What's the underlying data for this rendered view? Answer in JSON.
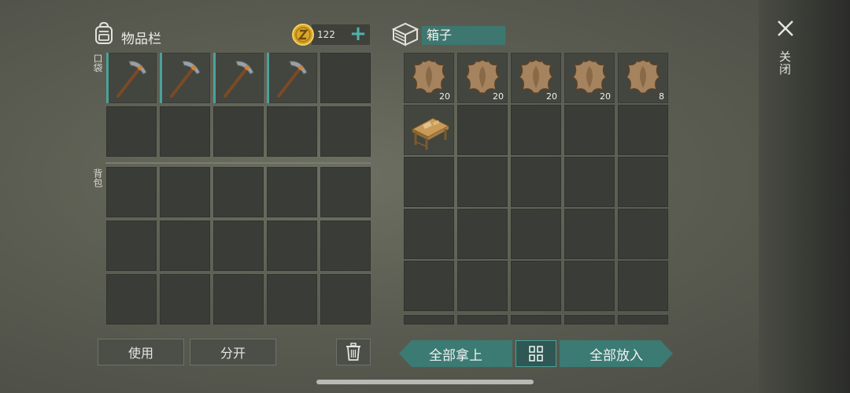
{
  "inventory": {
    "title": "物品栏",
    "pocket_label": "口袋",
    "backpack_label": "背包",
    "coins": "122",
    "coin_add": "+",
    "pocket_items": [
      "pickaxe",
      "pickaxe",
      "pickaxe",
      "pickaxe",
      null,
      null,
      null,
      null,
      null,
      null
    ],
    "backpack_slot_count": 15
  },
  "container": {
    "name": "箱子",
    "items": [
      {
        "item": "hide",
        "qty": "20"
      },
      {
        "item": "hide",
        "qty": "20"
      },
      {
        "item": "hide",
        "qty": "20"
      },
      {
        "item": "hide",
        "qty": "20"
      },
      {
        "item": "hide",
        "qty": "8"
      },
      {
        "item": "workbench",
        "qty": ""
      }
    ],
    "slot_count": 25
  },
  "buttons": {
    "use": "使用",
    "split": "分开",
    "take_all": "全部拿上",
    "put_all": "全部放入",
    "close": "关闭"
  },
  "icons": {
    "bag": "backpack-icon",
    "coin": "coin-icon",
    "box": "box-icon",
    "close": "close-icon",
    "trash": "trash-icon",
    "sort": "sort-grid-icon"
  },
  "colors": {
    "accent": "#4aa29b",
    "accent_dark": "#3c7a74"
  }
}
